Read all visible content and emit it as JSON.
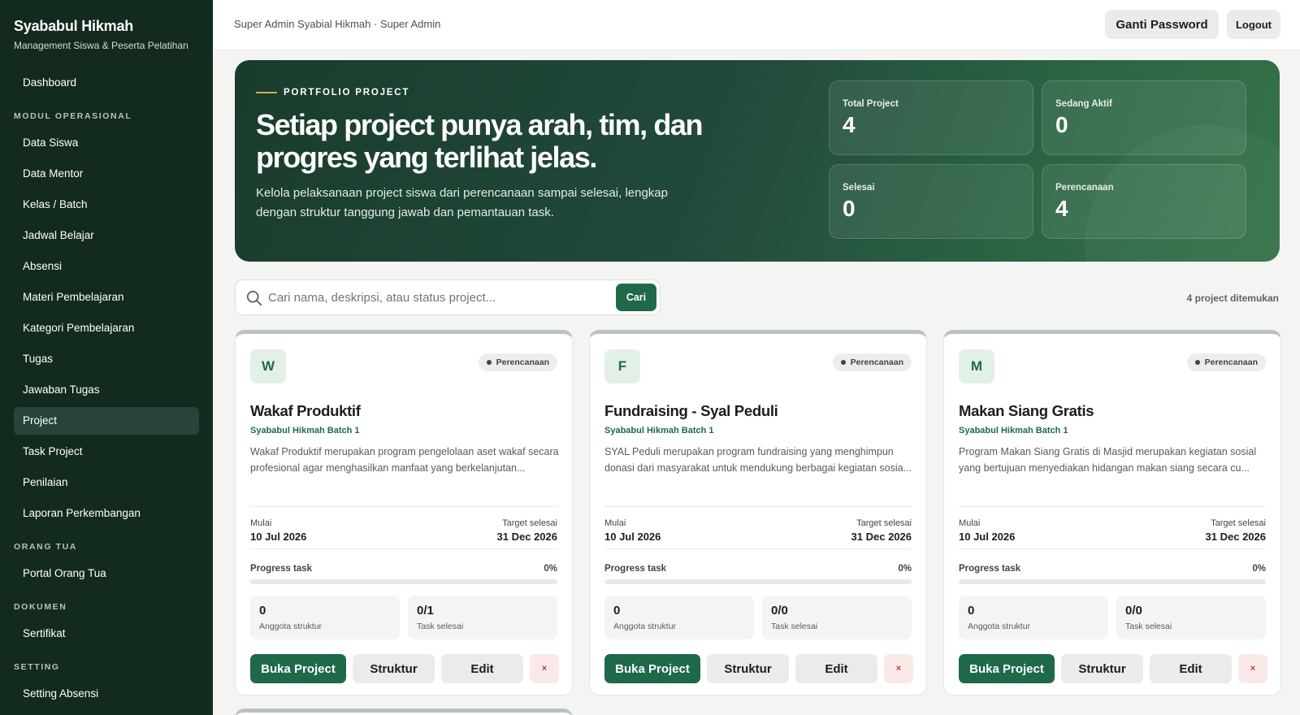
{
  "sidebar": {
    "brand_title": "Syababul Hikmah",
    "brand_subtitle": "Management Siswa & Peserta Pelatihan",
    "dashboard": "Dashboard",
    "section_modul": "MODUL OPERASIONAL",
    "modul_items": [
      "Data Siswa",
      "Data Mentor",
      "Kelas / Batch",
      "Jadwal Belajar",
      "Absensi",
      "Materi Pembelajaran",
      "Kategori Pembelajaran",
      "Tugas",
      "Jawaban Tugas",
      "Project",
      "Task Project",
      "Penilaian",
      "Laporan Perkembangan"
    ],
    "active_item": "Project",
    "section_parent": "ORANG TUA",
    "parent_items": [
      "Portal Orang Tua"
    ],
    "section_docs": "DOKUMEN",
    "docs_items": [
      "Sertifikat"
    ],
    "section_setting": "SETTING",
    "setting_items": [
      "Setting Absensi"
    ]
  },
  "header": {
    "breadcrumb": "Super Admin Syabial Hikmah · Super Admin",
    "change_password": "Ganti Password",
    "logout": "Logout"
  },
  "hero": {
    "eyebrow": "PORTFOLIO PROJECT",
    "title": "Setiap project punya arah, tim, dan progres yang terlihat jelas.",
    "description": "Kelola pelaksanaan project siswa dari perencanaan sampai selesai, lengkap dengan struktur tanggung jawab dan pemantauan task.",
    "stats": [
      {
        "label": "Total Project",
        "value": "4"
      },
      {
        "label": "Sedang Aktif",
        "value": "0"
      },
      {
        "label": "Selesai",
        "value": "0"
      },
      {
        "label": "Perencanaan",
        "value": "4"
      }
    ]
  },
  "search": {
    "placeholder": "Cari nama, deskripsi, atau status project...",
    "button": "Cari",
    "result_count": "4 project ditemukan"
  },
  "labels": {
    "start": "Mulai",
    "target": "Target selesai",
    "progress": "Progress task",
    "members": "Anggota struktur",
    "tasks_done": "Task selesai",
    "open": "Buka Project",
    "structure": "Struktur",
    "edit": "Edit",
    "delete": "×"
  },
  "projects": [
    {
      "initial": "W",
      "status": "Perencanaan",
      "title": "Wakaf Produktif",
      "batch": "Syababul Hikmah Batch 1",
      "description": "Wakaf Produktif merupakan program pengelolaan aset wakaf secara profesional agar menghasilkan manfaat yang berkelanjutan...",
      "start_date": "10 Jul 2026",
      "target_date": "31 Dec 2026",
      "progress_label": "0%",
      "progress": 0,
      "members": "0",
      "tasks": "0/1"
    },
    {
      "initial": "F",
      "status": "Perencanaan",
      "title": "Fundraising - Syal Peduli",
      "batch": "Syababul Hikmah Batch 1",
      "description": "SYAL Peduli merupakan program fundraising yang menghimpun donasi dari masyarakat untuk mendukung berbagai kegiatan sosia...",
      "start_date": "10 Jul 2026",
      "target_date": "31 Dec 2026",
      "progress_label": "0%",
      "progress": 0,
      "members": "0",
      "tasks": "0/0"
    },
    {
      "initial": "M",
      "status": "Perencanaan",
      "title": "Makan Siang Gratis",
      "batch": "Syababul Hikmah Batch 1",
      "description": "Program Makan Siang Gratis di Masjid merupakan kegiatan sosial yang bertujuan menyediakan hidangan makan siang secara cu...",
      "start_date": "10 Jul 2026",
      "target_date": "31 Dec 2026",
      "progress_label": "0%",
      "progress": 0,
      "members": "0",
      "tasks": "0/0"
    }
  ],
  "colors": {
    "sidebar_bg": "#132a1f",
    "accent": "#1e6a48",
    "hero_from": "#1a3c2c",
    "hero_to": "#367349",
    "eyebrow_line": "#d9a94a"
  }
}
